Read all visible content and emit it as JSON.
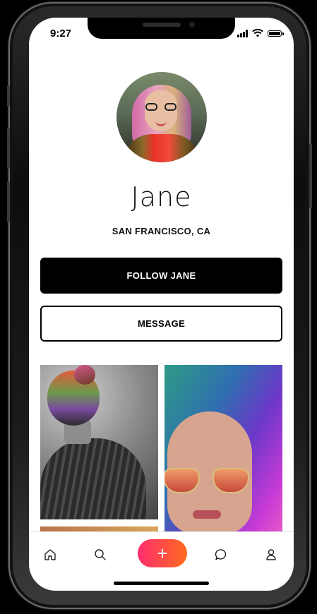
{
  "status_bar": {
    "time": "9:27"
  },
  "profile": {
    "name": "Jane",
    "location": "SAN FRANCISCO, CA"
  },
  "actions": {
    "follow_label": "FOLLOW JANE",
    "message_label": "MESSAGE"
  },
  "tab_bar": {
    "items": [
      {
        "icon": "home-icon"
      },
      {
        "icon": "search-icon"
      },
      {
        "icon": "plus-icon",
        "label": "+"
      },
      {
        "icon": "chat-bubble-icon"
      },
      {
        "icon": "user-icon"
      }
    ],
    "add_gradient": [
      "#ff2d6f",
      "#ff6a1f"
    ]
  }
}
